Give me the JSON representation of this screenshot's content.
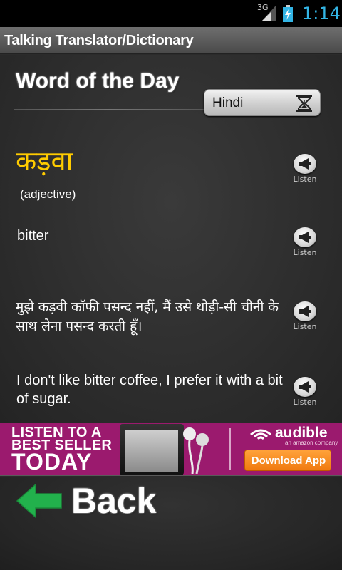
{
  "status": {
    "network": "3G",
    "time": "1:14"
  },
  "app": {
    "title": "Talking Translator/Dictionary"
  },
  "wod": {
    "heading": "Word of the Day",
    "language": "Hindi",
    "word": "कड़वा",
    "part_of_speech": "(adjective)",
    "meaning": "bitter",
    "example_hindi": "मुझे कड़वी कॉफी पसन्द नहीं, मैं उसे थोड़ी-सी चीनी के साथ लेना पसन्द करती हूँ।",
    "example_english": "I don't like bitter coffee, I prefer it with a bit of sugar.",
    "listen_label": "Listen"
  },
  "ad": {
    "line1": "LISTEN TO A",
    "line2": "BEST SELLER",
    "line3": "TODAY",
    "brand": "audible",
    "brand_sub": "an amazon company",
    "cta": "Download App"
  },
  "nav": {
    "back_label": "Back"
  },
  "colors": {
    "word": "#ffcc00",
    "time": "#33b5e5",
    "ad_bg": "#9b1a6e",
    "back_arrow": "#22b14c"
  }
}
